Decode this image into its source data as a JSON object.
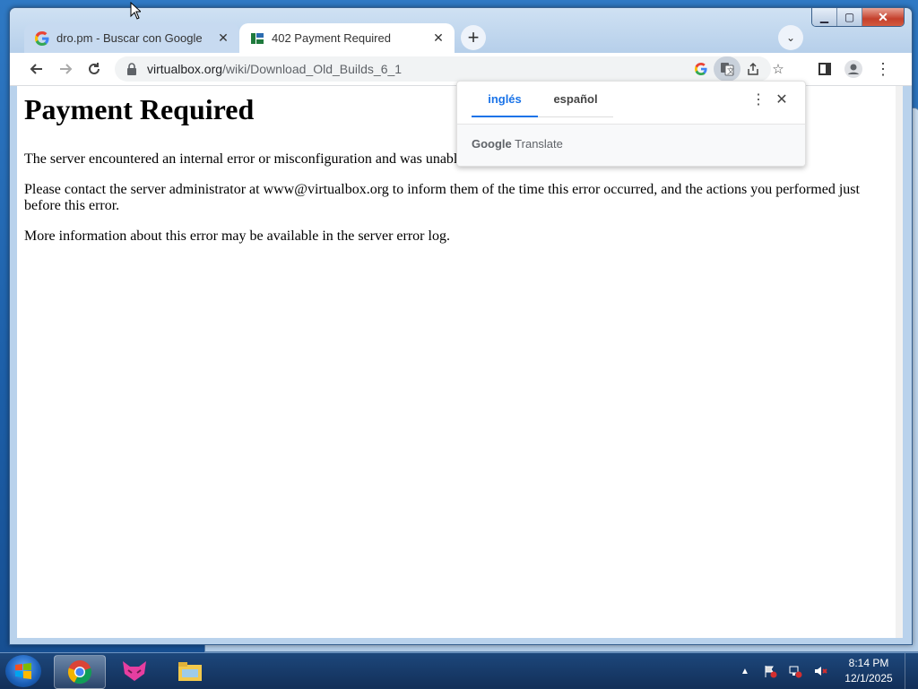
{
  "browser": {
    "tabs": [
      {
        "label": "dro.pm - Buscar con Google",
        "favicon": "google-icon",
        "active": false
      },
      {
        "label": "402 Payment Required",
        "favicon": "virtualbox-icon",
        "active": true
      }
    ],
    "url_host": "virtualbox.org",
    "url_path": "/wiki/Download_Old_Builds_6_1"
  },
  "page": {
    "heading": "Payment Required",
    "para1": "The server encountered an internal error or misconfiguration and was unable to complete your request.",
    "para2": "Please contact the server administrator at www@virtualbox.org to inform them of the time this error occurred, and the actions you performed just before this error.",
    "para3": "More information about this error may be available in the server error log."
  },
  "translate_popup": {
    "source_lang": "inglés",
    "target_lang": "español",
    "brand_google": "Google",
    "brand_translate": "Translate"
  },
  "taskbar": {
    "time": "8:14 PM",
    "date": "12/1/2025"
  },
  "colors": {
    "accent": "#1a73e8",
    "taskbar": "#1e4678"
  }
}
